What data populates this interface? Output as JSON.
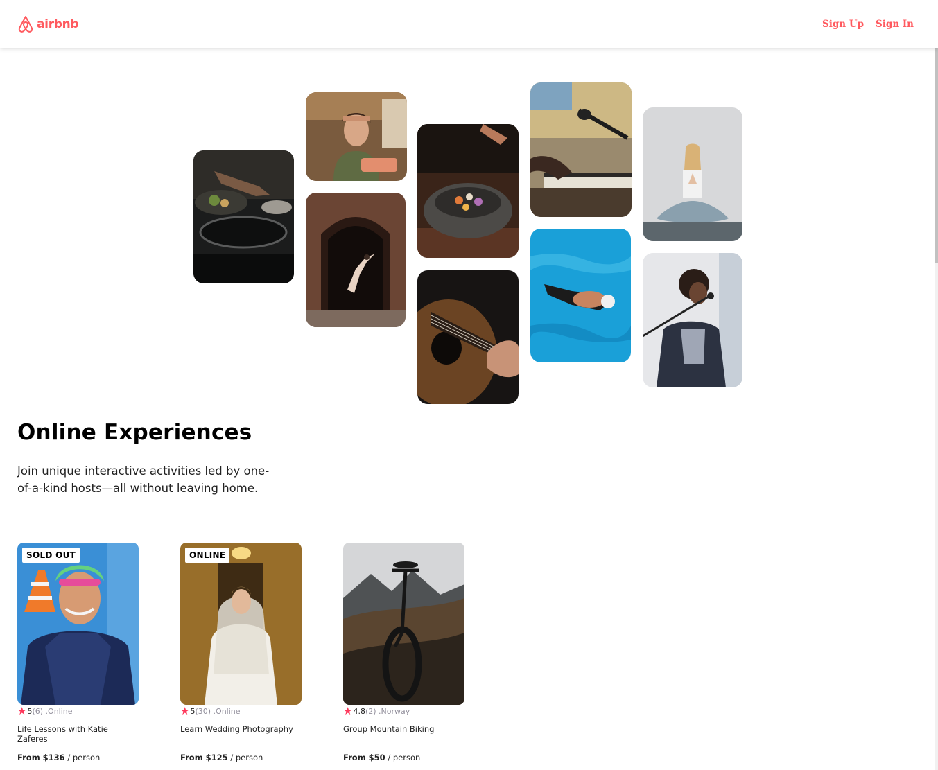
{
  "brand": {
    "name": "airbnb",
    "accent": "#FF5A5F"
  },
  "nav": {
    "sign_up": "Sign Up",
    "sign_in": "Sign In"
  },
  "hero": {
    "title": "Online Experiences",
    "description": "Join unique interactive activities led by one-of-a-kind hosts—all without leaving home."
  },
  "cards": [
    {
      "badge": "SOLD OUT",
      "rating": "5",
      "review_count": "(6)",
      "location": "Online",
      "title": "Life Lessons with Katie Zaferes",
      "price": "From $136",
      "per": "/ person"
    },
    {
      "badge": "ONLINE",
      "rating": "5",
      "review_count": "(30)",
      "location": "Online",
      "title": "Learn Wedding Photography",
      "price": "From $125",
      "per": "/ person"
    },
    {
      "badge": "",
      "rating": "4.8",
      "review_count": "(2)",
      "location": "Norway",
      "title": "Group Mountain Biking",
      "price": "From $50",
      "per": "/ person"
    }
  ]
}
